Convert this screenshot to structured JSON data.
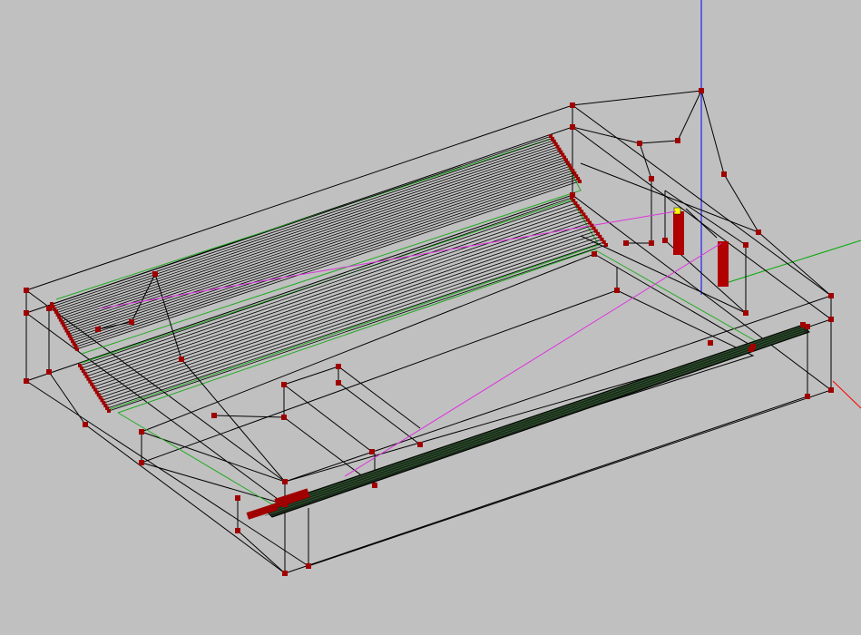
{
  "viewport": {
    "background": "#c0c0c0",
    "edge_color": "#000000",
    "vertex_color": "#8b0000",
    "guide_color": "#22aa22",
    "link_color": "#dd33dd",
    "axis_colors": {
      "x": "#ff0000",
      "y": "#00aa00",
      "z": "#0000ff"
    },
    "selection_color": "#ffff00"
  }
}
